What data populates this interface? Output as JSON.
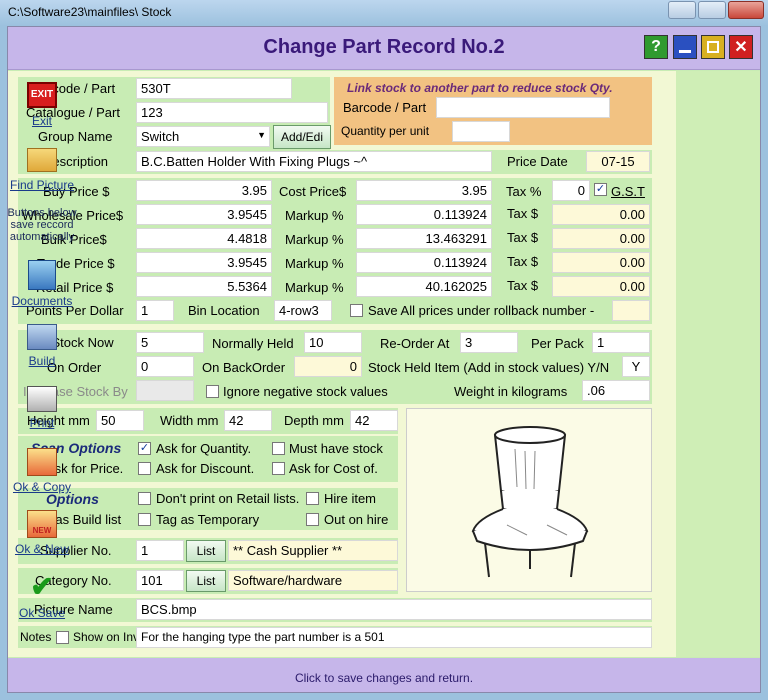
{
  "window": {
    "title": "C:\\Software23\\mainfiles\\ Stock"
  },
  "header": {
    "title": "Change Part Record No.2",
    "help": "?"
  },
  "fields": {
    "barcode_label": "Barcode / Part",
    "barcode": "530T",
    "catalogue_label": "Catalogue / Part",
    "catalogue": "123",
    "group_label": "Group Name",
    "group": "Switch",
    "add_edit": "Add/Edi",
    "description_label": "Description",
    "description": "B.C.Batten Holder With Fixing Plugs ~^",
    "price_date_label": "Price Date",
    "price_date": "07-15"
  },
  "link_stock": {
    "title": "Link stock to another part to reduce stock Qty.",
    "barcode_label": "Barcode / Part",
    "barcode": "",
    "qty_label": "Quantity per unit",
    "qty": ""
  },
  "prices": {
    "buy_label": "Buy Price $",
    "buy": "3.95",
    "cost_label": "Cost Price$",
    "cost": "3.95",
    "taxpct_label": "Tax %",
    "taxpct": "0",
    "gst_label": "G.S.T",
    "rows": [
      {
        "label": "Wholesale Price$",
        "price": "3.9545",
        "markup_label": "Markup %",
        "markup": "0.113924",
        "tax_label": "Tax $",
        "tax": "0.00"
      },
      {
        "label": "Bulk Price$",
        "price": "4.4818",
        "markup_label": "Markup %",
        "markup": "13.463291",
        "tax_label": "Tax $",
        "tax": "0.00"
      },
      {
        "label": "Trade Price $",
        "price": "3.9545",
        "markup_label": "Markup %",
        "markup": "0.113924",
        "tax_label": "Tax $",
        "tax": "0.00"
      },
      {
        "label": "Retail Price $",
        "price": "5.5364",
        "markup_label": "Markup %",
        "markup": "40.162025",
        "tax_label": "Tax $",
        "tax": "0.00"
      }
    ],
    "points_label": "Points Per Dollar",
    "points": "1",
    "bin_label": "Bin Location",
    "bin": "4-row3",
    "save_all_label": "Save All prices under rollback number -",
    "rollback": ""
  },
  "stock": {
    "in_stock_label": "In Stock Now",
    "in_stock": "5",
    "normally_label": "Normally Held",
    "normally": "10",
    "reorder_label": "Re-Order At",
    "reorder": "3",
    "perpack_label": "Per Pack",
    "perpack": "1",
    "onorder_label": "On Order",
    "onorder": "0",
    "backorder_label": "On BackOrder",
    "backorder": "0",
    "held_label": "Stock Held Item (Add in stock values) Y/N",
    "held": "Y",
    "increase_label": "Increase Stock By",
    "increase": "",
    "ignore_label": "Ignore negative stock values",
    "weight_label": "Weight in kilograms",
    "weight": ".06"
  },
  "dims": {
    "height_label": "Height mm",
    "height": "50",
    "width_label": "Width mm",
    "width": "42",
    "depth_label": "Depth mm",
    "depth": "42"
  },
  "scan": {
    "title": "Scan Options",
    "ask_qty": "Ask for Quantity.",
    "must_have": "Must have stock",
    "ask_price": "Ask for Price.",
    "ask_discount": "Ask for Discount.",
    "ask_cost": "Ask for Cost of."
  },
  "options": {
    "title": "Options",
    "dont_print": "Don't print on Retail lists.",
    "hire_item": "Hire item",
    "has_build": "Has Build list",
    "tag_temp": "Tag as Temporary",
    "out_hire": "Out on hire"
  },
  "supplier": {
    "label": "Supplier No.",
    "value": "1",
    "list": "List",
    "name": "** Cash Supplier **"
  },
  "category": {
    "label": "Category No.",
    "value": "101",
    "list": "List",
    "name": "Software/hardware"
  },
  "picture": {
    "label": "Picture Name",
    "value": "BCS.bmp"
  },
  "notes": {
    "label": "Notes",
    "show_label": "Show on Inv",
    "value": "For the hanging type the part number is a 501"
  },
  "sidebar": {
    "exit": "Exit",
    "exit_icon_text": "EXIT",
    "find_picture": "Find Picture",
    "note": "Buttons below save reccord automatically",
    "documents": "Documents",
    "build": "Build",
    "print": "Print",
    "ok_copy": "Ok & Copy",
    "ok_new": "Ok & New",
    "ok_new_icon_text": "NEW",
    "ok_save": "Ok Save"
  },
  "status": "Click to save changes  and return."
}
